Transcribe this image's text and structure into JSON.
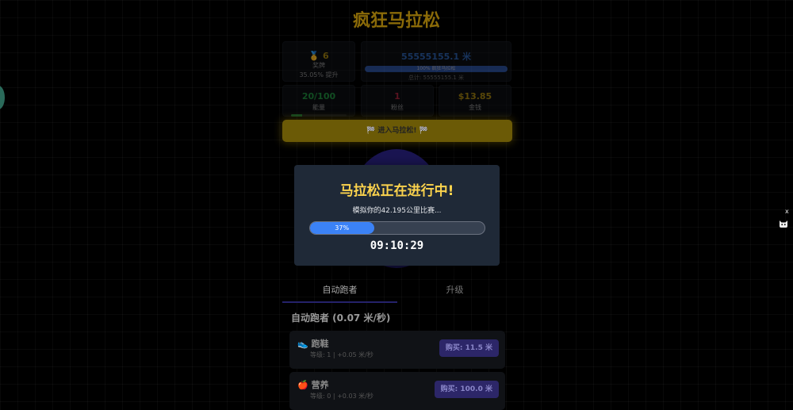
{
  "game": {
    "title": "疯狂马拉松"
  },
  "stats": {
    "medals": {
      "icon": "🥇",
      "value": "6",
      "label": "奖牌",
      "sub": "35.05% 提升"
    },
    "distance": {
      "value": "55555155.1 米",
      "bar_text": "100% 疯狂马拉松",
      "progress_percent": 100,
      "total": "总计: 55555155.1 米"
    },
    "energy": {
      "value": "20/100",
      "label": "能量",
      "fill_percent": 20
    },
    "fans": {
      "value": "1",
      "label": "粉丝"
    },
    "money": {
      "value": "$13.85",
      "label": "金钱"
    }
  },
  "start_button": {
    "label": "🏁 进入马拉松! 🏁"
  },
  "tabs": [
    {
      "label": "自动跑者"
    },
    {
      "label": "升级"
    }
  ],
  "section": {
    "title": "自动跑者 (0.07 米/秒)"
  },
  "upgrades": [
    {
      "icon": "👟",
      "name": "跑鞋",
      "info": "等级: 1 | +0.05 米/秒",
      "buy": "购买: 11.5 米"
    },
    {
      "icon": "🍎",
      "name": "营养",
      "info": "等级: 0 | +0.03 米/秒",
      "buy": "购买: 100.0 米"
    }
  ],
  "modal": {
    "title": "马拉松正在进行中!",
    "subtitle": "模拟你的42.195公里比赛...",
    "progress_percent": 37,
    "progress_text": "37%",
    "timer": "09:10:29"
  },
  "side_widget": {
    "close_label": "x",
    "icon": "cat-icon"
  },
  "colors": {
    "gold": "#fcd34d",
    "blue": "#3b82f6",
    "modal_bg": "#1f2937"
  }
}
